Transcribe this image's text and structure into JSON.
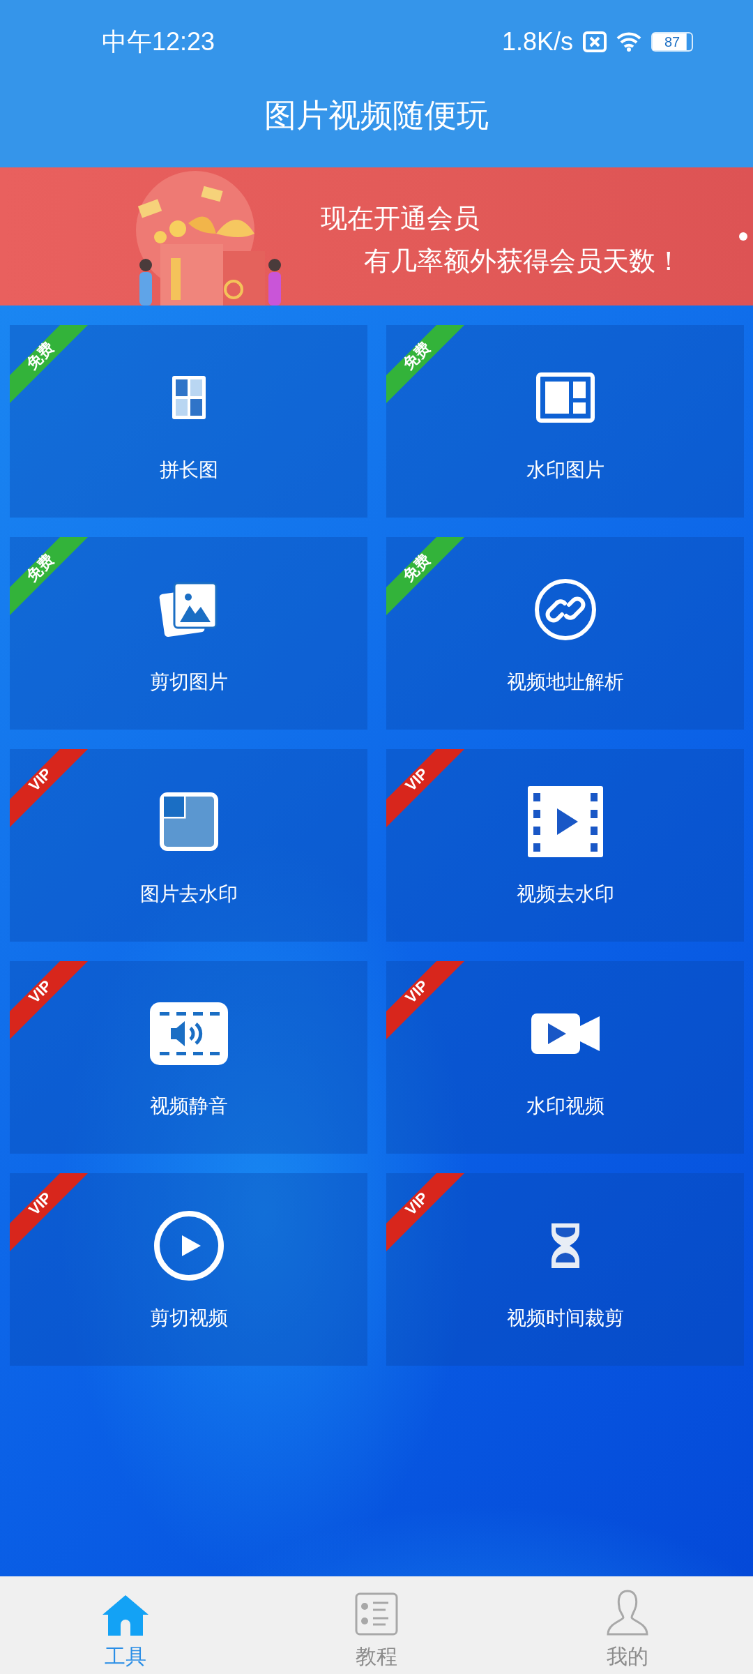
{
  "status_bar": {
    "time": "中午12:23",
    "net_speed": "1.8K/s",
    "battery": "87"
  },
  "title": "图片视频随便玩",
  "banner": {
    "kind": "picture",
    "headline": "现在开通会员",
    "subline": "有几率额外获得会员天数！",
    "dots": [
      {
        "selected": true
      }
    ]
  },
  "tools": [
    {
      "label": "拼长图",
      "badge": {
        "kind": "free",
        "text": "免费"
      }
    },
    {
      "label": "水印图片",
      "badge": {
        "kind": "free",
        "text": "免费"
      }
    },
    {
      "label": "剪切图片",
      "badge": {
        "kind": "free",
        "text": "免费"
      }
    },
    {
      "label": "视频地址解析",
      "badge": {
        "kind": "free",
        "text": "免费"
      }
    },
    {
      "label": "图片去水印",
      "badge": {
        "kind": "vip",
        "text": "VIP"
      }
    },
    {
      "label": "视频去水印",
      "badge": {
        "kind": "vip",
        "text": "VIP"
      }
    },
    {
      "label": "视频静音",
      "badge": {
        "kind": "vip",
        "text": "VIP"
      }
    },
    {
      "label": "水印视频",
      "badge": {
        "kind": "vip",
        "text": "VIP"
      }
    },
    {
      "label": "剪切视频",
      "badge": {
        "kind": "vip",
        "text": "VIP"
      }
    },
    {
      "label": "视频时间裁剪",
      "badge": {
        "kind": "vip",
        "text": "VIP"
      }
    }
  ],
  "nav": [
    {
      "label": "工具",
      "selected": true
    },
    {
      "label": "教程",
      "selected": false
    },
    {
      "label": "我的",
      "selected": false
    }
  ]
}
